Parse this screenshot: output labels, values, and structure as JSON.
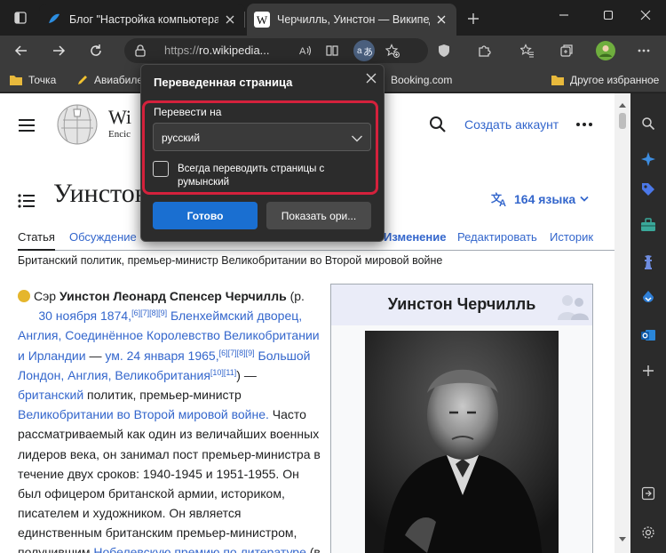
{
  "tabs": [
    {
      "title": "Блог \"Настройка компьютера\"",
      "active": false
    },
    {
      "title": "Черчилль, Уинстон — Википедия",
      "active": true
    }
  ],
  "address": {
    "protocol": "https://",
    "host": "ro.wikipedia..."
  },
  "bookmarks": [
    {
      "label": "Точка"
    },
    {
      "label": "Авиабиле"
    },
    {
      "label": "Booking.com"
    },
    {
      "label": "Другое избранное"
    }
  ],
  "wiki": {
    "logo_text": "Wi",
    "logo_sub": "Encic",
    "create_account": "Создать аккаунт",
    "title": "Уинстон",
    "languages": "164 языка",
    "tabs": [
      {
        "label": "Статья"
      },
      {
        "label": "Обсуждение"
      },
      {
        "label": "Изменение"
      },
      {
        "label": "Редактировать"
      },
      {
        "label": "Историк"
      }
    ],
    "description": "Британский политик, премьер-министр Великобритании во Второй мировой войне",
    "infobox_title": "Уинстон Черчилль"
  },
  "article": {
    "p1": "Сэр ",
    "name": "Уинстон Леонард Спенсер Черчилль",
    "p2": " (р.",
    "l2a": "30 ноября 1874,",
    "r1": "[6][7][8][9]",
    "l2b": " Бленхеймский дворец,",
    "l3": "Англия, Соединённое Королевство Великобритании",
    "l4a": "и Ирландии",
    "l4b": " — ",
    "l4c": "ум. 24 января 1965,",
    "r2": "[6][7][8][9]",
    "l4d": " Большой",
    "l5a": "Лондон, Англия, Великобритания",
    "r3": "[10][11]",
    "l5b": ") —",
    "l6a": "британский",
    "l6b": " политик, премьер-министр",
    "l7a": "Великобритании во Второй мировой войне.",
    "l7b": " Часто",
    "l8": "рассматриваемый как один из величайших военных",
    "l9": "лидеров века, он занимал пост премьер-министра в",
    "l10": "течение двух сроков: 1940-1945 и 1951-1955. Он",
    "l11": "был офицером британской армии, историком,",
    "l12": "писателем и художником. Он является",
    "l13": "единственным британским премьер-министром,",
    "l14a": "получившим ",
    "l14b": "Нобелевскую премию по литературе",
    "l14c": " (в"
  },
  "popup": {
    "title": "Переведенная страница",
    "translate_to_label": "Перевести на",
    "selected_language": "русский",
    "always_translate": "Всегда переводить страницы с румынский",
    "done_button": "Готово",
    "show_original_button": "Показать ори..."
  },
  "colors": {
    "accent": "#1a6fd1",
    "highlight": "#d4213c",
    "link": "#3366cc"
  }
}
